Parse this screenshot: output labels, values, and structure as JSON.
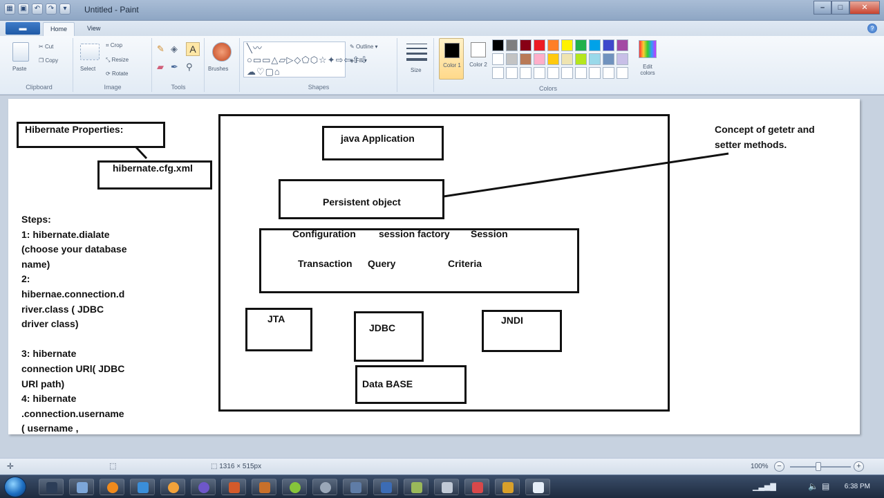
{
  "window": {
    "title": "Untitled - Paint",
    "controls": {
      "minimize": "–",
      "maximize": "□",
      "close": "✕"
    }
  },
  "ribbon_tabs": {
    "file": "▬",
    "home": "Home",
    "view": "View"
  },
  "ribbon": {
    "clipboard": {
      "label": "Clipboard",
      "paste": "Paste",
      "cut": "Cut",
      "copy": "Copy"
    },
    "image": {
      "label": "Image",
      "select": "Select",
      "crop": "Crop",
      "resize": "Resize",
      "rotate": "Rotate"
    },
    "tools": {
      "label": "Tools"
    },
    "brushes": {
      "label": "Brushes"
    },
    "shapes": {
      "label": "Shapes",
      "outline": "Outline",
      "fill": "Fill",
      "glyphs": "╲〰○▭▭△▱▷◇⬠⬡☆✦⇨⇦⇧⇩☁♡▢⌂"
    },
    "size": {
      "label": "Size"
    },
    "colors": {
      "label": "Colors",
      "color1": "Color 1",
      "color2": "Color 2",
      "edit_colors": "Edit colors",
      "color1_value": "#000000",
      "color2_value": "#ffffff",
      "palette": [
        "#000000",
        "#7f7f7f",
        "#880015",
        "#ed1c24",
        "#ff7f27",
        "#fff200",
        "#22b14c",
        "#00a2e8",
        "#3f48cc",
        "#a349a4",
        "#ffffff",
        "#c3c3c3",
        "#b97a57",
        "#ffaec9",
        "#ffc90e",
        "#efe4b0",
        "#b5e61d",
        "#99d9ea",
        "#7092be",
        "#c8bfe7",
        "#ffffff",
        "#ffffff",
        "#ffffff",
        "#ffffff",
        "#ffffff",
        "#ffffff",
        "#ffffff",
        "#ffffff",
        "#ffffff",
        "#ffffff"
      ]
    }
  },
  "drawing": {
    "hibernate_properties": "Hibernate Properties:",
    "cfg_xml": "hibernate.cfg.xml",
    "java_application": "java Application",
    "persistent_object": "Persistent object",
    "api_row1": {
      "configuration": "Configuration",
      "session_factory": "session factory",
      "session": "Session"
    },
    "api_row2": {
      "transaction": "Transaction",
      "query": "Query",
      "criteria": "Criteria"
    },
    "jta": "JTA",
    "jdbc": "JDBC",
    "jndi": "JNDI",
    "database": "Data BASE",
    "note_line1": "Concept of getetr and",
    "note_line2": "setter methods.",
    "steps": [
      "Steps:",
      "1: hibernate.dialate",
      "(choose your database",
      "name)",
      "2:",
      "hibernae.connection.d",
      "river.class ( JDBC",
      "driver class)",
      "",
      "3: hibernate",
      "connection URl( JDBC",
      "URl path)",
      "4: hibernate",
      ".connection.username",
      "( username ,"
    ]
  },
  "statusbar": {
    "canvas_size": "1316 × 515px",
    "zoom": "100%",
    "zoom_out": "−",
    "zoom_in": "+"
  },
  "taskbar": {
    "clock": "6:38 PM"
  }
}
